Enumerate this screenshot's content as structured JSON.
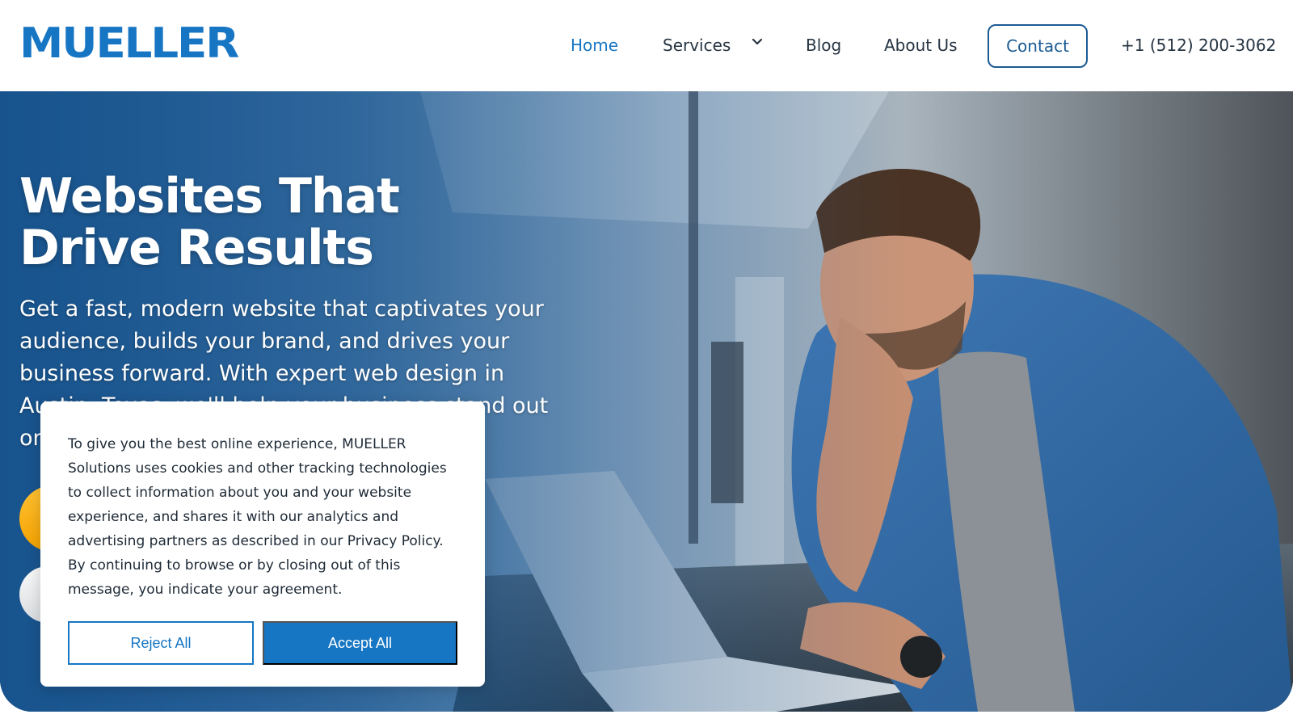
{
  "brand": {
    "logo_text": "MUELLER",
    "primary_color": "#1776c4",
    "accent_color": "#f5a100"
  },
  "nav": {
    "items": [
      {
        "label": "Home",
        "active": true
      },
      {
        "label": "Services",
        "has_dropdown": true
      },
      {
        "label": "Blog"
      },
      {
        "label": "About Us"
      }
    ],
    "contact_label": "Contact",
    "phone": "+1 (512) 200-3062",
    "dropdown_icon": "chevron-down-icon"
  },
  "hero": {
    "title_line1": "Websites That",
    "title_line2": "Drive Results",
    "subtitle": "Get a fast, modern website that captivates your audience, builds your brand, and drives your business forward. With expert web design in Austin, Texas, we'll help your business stand out online."
  },
  "cookie_banner": {
    "text": "To give you the best online experience, MUELLER Solutions uses cookies and other tracking technologies to collect information about you and your website experience, and shares it with our analytics and advertising partners as described in our Privacy Policy. By continuing to browse or by closing out of this message, you indicate your agreement.",
    "reject_label": "Reject All",
    "accept_label": "Accept All"
  }
}
